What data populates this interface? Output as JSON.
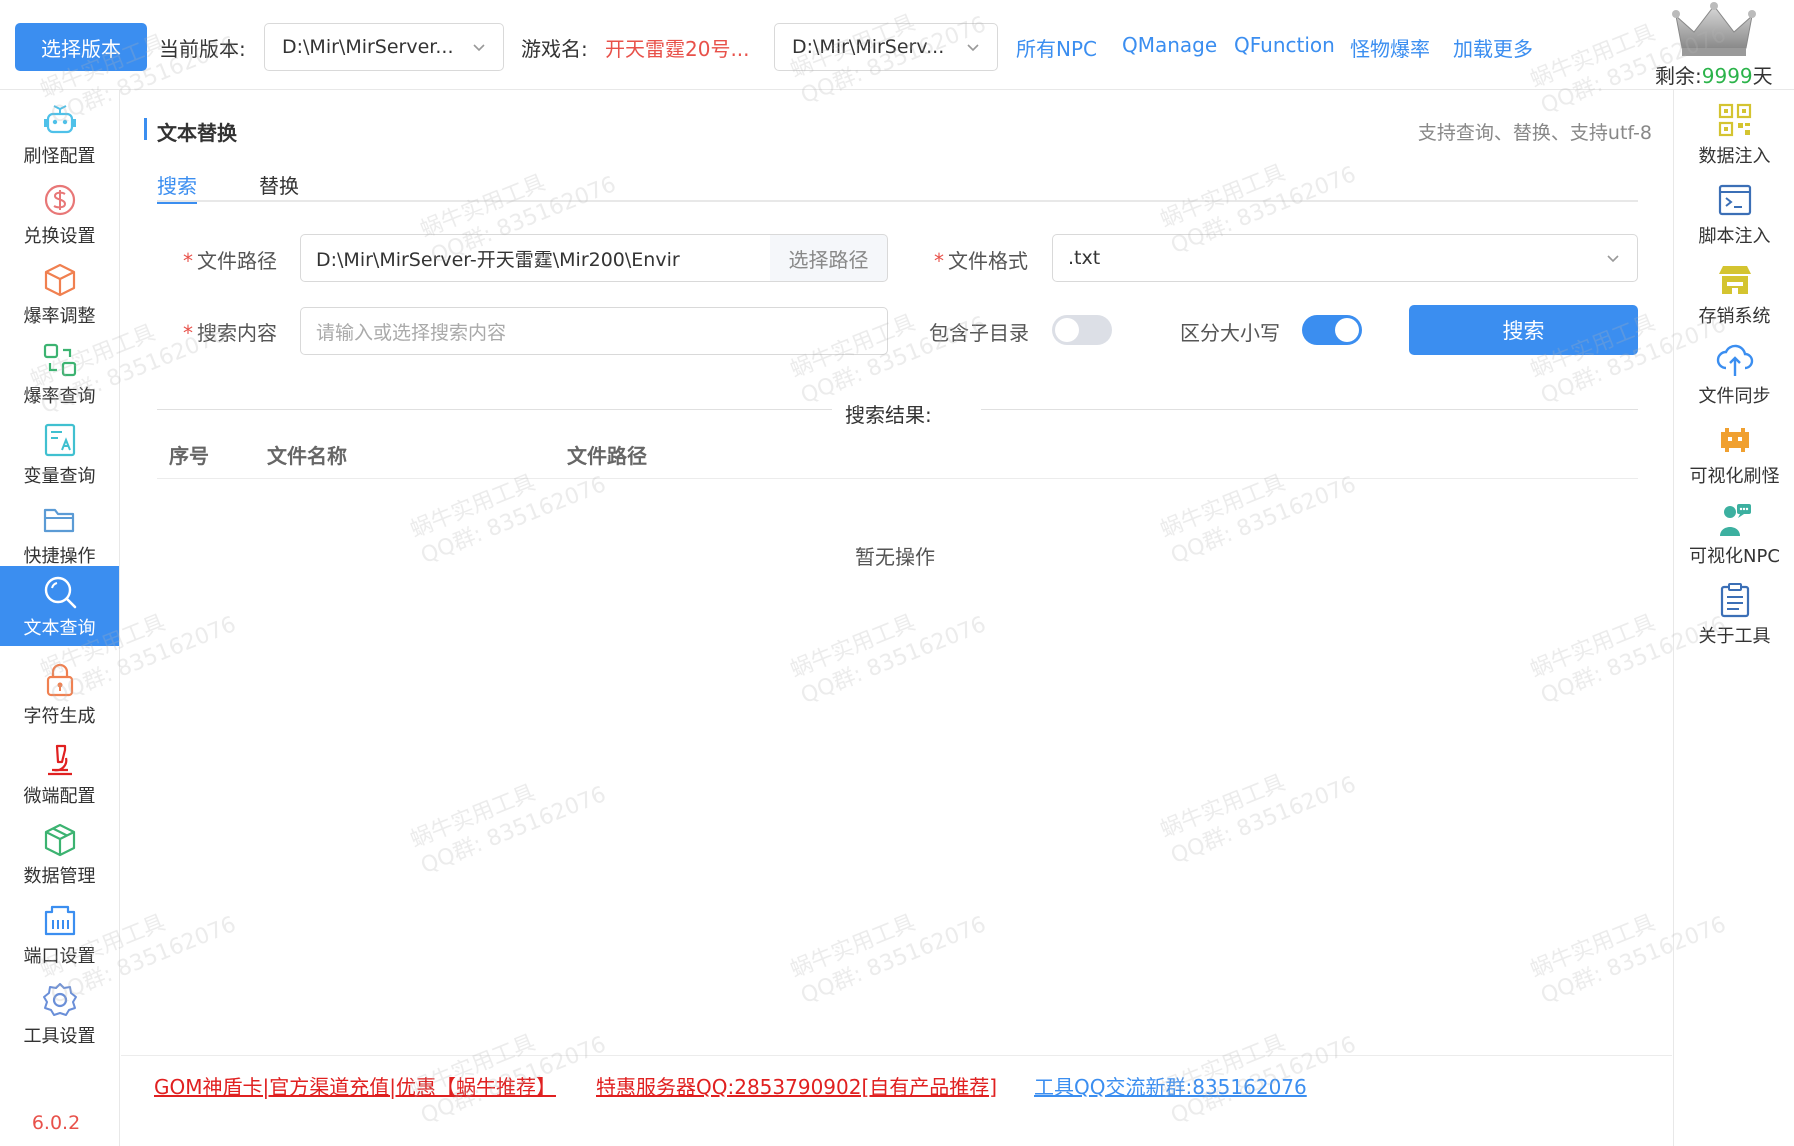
{
  "topbar": {
    "select_version_label": "选择版本",
    "current_version_label": "当前版本:",
    "current_version_value": "D:\\Mir\\MirServer...",
    "game_name_label": "游戏名:",
    "game_name_value": "开天雷霆20号...",
    "server_path_value": "D:\\Mir\\MirServ...",
    "links": [
      "所有NPC",
      "QManage",
      "QFunction",
      "怪物爆率",
      "加载更多"
    ],
    "remain_prefix": "剩余:",
    "remain_days": "9999",
    "remain_suffix": "天"
  },
  "left_sidebar": {
    "items": [
      {
        "label": "刷怪配置",
        "icon": "robot-icon",
        "color": "#4fc1e9"
      },
      {
        "label": "兑换设置",
        "icon": "dollar-icon",
        "color": "#e87777"
      },
      {
        "label": "爆率调整",
        "icon": "cube-icon",
        "color": "#f08050"
      },
      {
        "label": "爆率查询",
        "icon": "refresh-squares-icon",
        "color": "#3cb371"
      },
      {
        "label": "变量查询",
        "icon": "text-form-icon",
        "color": "#40c0d0"
      },
      {
        "label": "快捷操作",
        "icon": "folder-icon",
        "color": "#5b9bd5"
      },
      {
        "label": "文本查询",
        "icon": "search-icon",
        "color": "#ffffff"
      },
      {
        "label": "字符生成",
        "icon": "lock-icon",
        "color": "#f08050"
      },
      {
        "label": "微端配置",
        "icon": "microscope-icon",
        "color": "#e02020"
      },
      {
        "label": "数据管理",
        "icon": "box-icon",
        "color": "#3cb371"
      },
      {
        "label": "端口设置",
        "icon": "port-icon",
        "color": "#3b8ef0"
      },
      {
        "label": "工具设置",
        "icon": "gear-icon",
        "color": "#6a8fd8"
      }
    ],
    "active_index": 6,
    "version": "6.0.2"
  },
  "right_sidebar": {
    "items": [
      {
        "label": "数据注入",
        "icon": "qrcode-icon",
        "color": "#d4c430"
      },
      {
        "label": "脚本注入",
        "icon": "terminal-icon",
        "color": "#3b6fb6"
      },
      {
        "label": "存销系统",
        "icon": "store-icon",
        "color": "#d4c430"
      },
      {
        "label": "文件同步",
        "icon": "cloud-sync-icon",
        "color": "#3b8ef0"
      },
      {
        "label": "可视化刷怪",
        "icon": "space-invader-icon",
        "color": "#f0a030"
      },
      {
        "label": "可视化NPC",
        "icon": "npc-icon",
        "color": "#3cb0a0"
      },
      {
        "label": "关于工具",
        "icon": "clipboard-icon",
        "color": "#3b6fb6"
      }
    ]
  },
  "main": {
    "title": "文本替换",
    "hint": "支持查询、替换、支持utf-8",
    "tabs": [
      "搜索",
      "替换"
    ],
    "active_tab": 0,
    "form": {
      "file_path_label": "文件路径",
      "file_path_value": "D:\\Mir\\MirServer-开天雷霆\\Mir200\\Envir",
      "choose_path_label": "选择路径",
      "file_format_label": "文件格式",
      "file_format_value": ".txt",
      "search_content_label": "搜索内容",
      "search_content_placeholder": "请输入或选择搜索内容",
      "include_subdir_label": "包含子目录",
      "include_subdir_on": false,
      "case_sensitive_label": "区分大小写",
      "case_sensitive_on": true,
      "search_button_label": "搜索"
    },
    "results": {
      "divider_label": "搜索结果:",
      "columns": [
        "序号",
        "文件名称",
        "文件路径"
      ],
      "rows": [],
      "empty_text": "暂无操作"
    }
  },
  "footer": {
    "links": [
      {
        "text": "GOM神盾卡|官方渠道充值|优惠【蜗牛推荐】",
        "color": "red"
      },
      {
        "text": "特惠服务器QQ:2853790902[自有产品推荐]",
        "color": "red"
      },
      {
        "text": "工具QQ交流新群:835162076",
        "color": "blue"
      }
    ]
  },
  "watermark": {
    "line1": "蜗牛实用工具",
    "line2": "QQ群: 835162076"
  },
  "colors": {
    "accent": "#3b8ef0",
    "danger": "#e8514a",
    "success": "#2bb34a"
  }
}
